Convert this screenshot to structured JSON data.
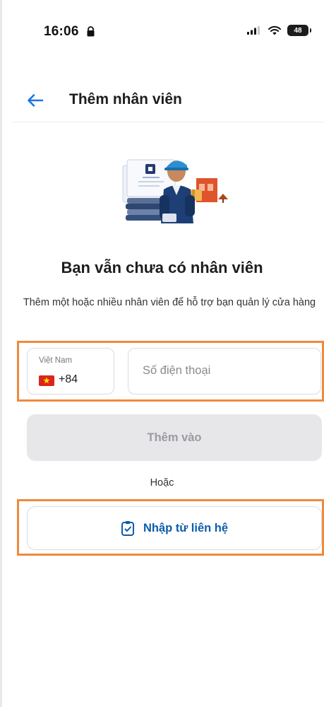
{
  "status_bar": {
    "time": "16:06",
    "battery": "48",
    "icons": [
      "lock-icon",
      "signal-icon",
      "wifi-icon",
      "battery-icon"
    ]
  },
  "header": {
    "back_icon": "back-arrow-icon",
    "title": "Thêm nhân viên"
  },
  "empty_state": {
    "illustration": "staff-illustration",
    "title": "Bạn vẫn chưa có nhân viên",
    "description": "Thêm một hoặc nhiều nhân viên để hỗ trợ bạn quản lý cửa hàng"
  },
  "phone_form": {
    "country_name": "Việt Nam",
    "dial_code": "+84",
    "phone_placeholder": "Số điện thoại",
    "phone_value": ""
  },
  "add_button": {
    "label": "Thêm vào",
    "enabled": false
  },
  "or_text": "Hoặc",
  "contact_button": {
    "label": "Nhập từ liên hệ",
    "icon": "contact-checklist-icon"
  },
  "colors": {
    "accent": "#0b5cad",
    "highlight": "#f08a3c",
    "disabled_button_bg": "#e7e7ea",
    "disabled_button_text": "#9a9aa0",
    "border": "#dcdcdf"
  }
}
